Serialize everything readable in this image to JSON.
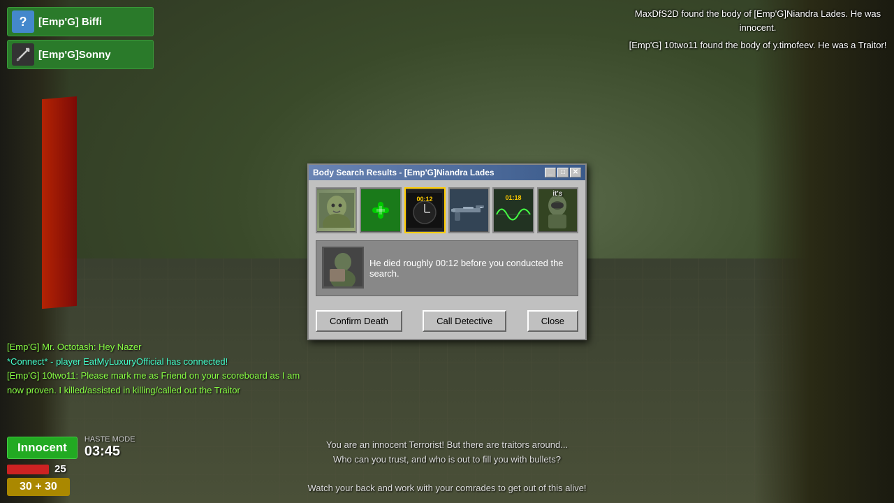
{
  "game": {
    "background_color": "#3a4a2a"
  },
  "event_log": {
    "lines": [
      "MaxDfS2D found the body of [Emp'G]Niandra Lades. He was innocent.",
      "[Emp'G] 10two11 found the body of y.timofeev. He was a Traitor!"
    ]
  },
  "players": [
    {
      "name": "[Emp'G] Biffi",
      "icon_type": "question"
    },
    {
      "name": "[Emp'G]Sonny",
      "icon_type": "knife"
    }
  ],
  "chat": [
    {
      "text": "[Emp'G] Mr. Octotash: Hey Nazer",
      "style": "green"
    },
    {
      "text": "*Connect* - player EatMyLuxuryOfficial has connected!",
      "style": "teal"
    },
    {
      "text": "[Emp'G] 10two11: Please mark me as Friend on your scoreboard as I am now proven. I killed/assisted in killing/called out the Traitor",
      "style": "green"
    }
  ],
  "hud": {
    "role": "Innocent",
    "haste_label": "HASTE MODE",
    "haste_time": "03:45",
    "health": 25,
    "ammo": "30 + 30"
  },
  "bottom_text": {
    "line1": "You are an innocent Terrorist! But there are traitors around...",
    "line2": "Who can you trust, and who is out to fill you with bullets?",
    "line3": "",
    "line4": "Watch your back and work with your comrades to get out of this alive!"
  },
  "modal": {
    "title": "Body Search Results - [Emp'G]Niandra Lades",
    "evidence_items": [
      {
        "type": "face",
        "label": "",
        "selected": false
      },
      {
        "type": "pill",
        "label": "",
        "selected": false
      },
      {
        "type": "timer",
        "label": "00:12",
        "selected": true
      },
      {
        "type": "rifle",
        "label": "",
        "selected": false
      },
      {
        "type": "wave",
        "label": "01:18",
        "selected": false
      },
      {
        "type": "char",
        "label": "it's",
        "selected": false
      }
    ],
    "info_text": "He died roughly 00:12 before you conducted the search.",
    "buttons": {
      "confirm": "Confirm Death",
      "detective": "Call Detective",
      "close": "Close"
    }
  }
}
